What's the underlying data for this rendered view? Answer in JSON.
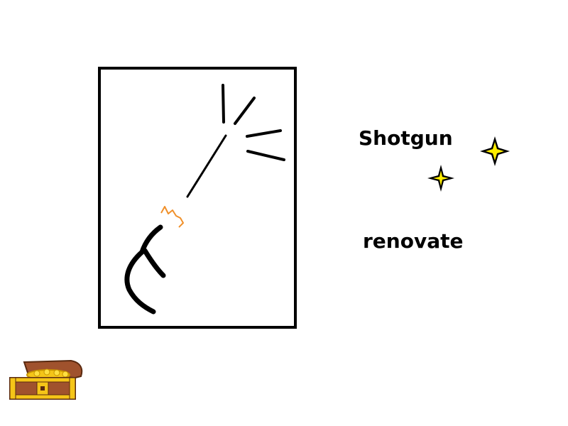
{
  "card": {
    "primary_word": "Shotgun",
    "secondary_word": "renovate"
  },
  "icons": {
    "sparkles": [
      "sparkle-icon",
      "sparkle-icon"
    ],
    "chest": "treasure-chest-icon"
  },
  "colors": {
    "ink": "#000000",
    "sparkle_fill": "#ffee00",
    "spark_orange": "#f0902a",
    "chest_wood": "#a0522d",
    "chest_gold": "#f5c518"
  }
}
